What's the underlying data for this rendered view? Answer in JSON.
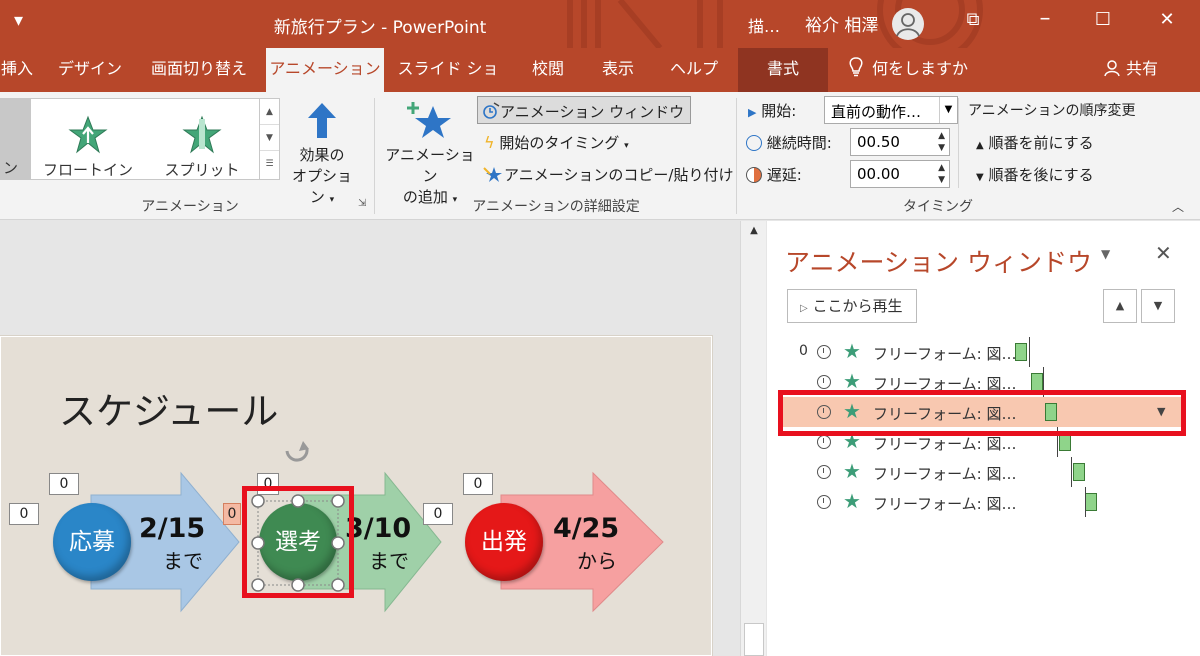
{
  "titlebar": {
    "qat_icon": "▾",
    "title": "新旅行プラン - PowerPoint",
    "cut_text": "描…",
    "user_name": "裕介 相澤",
    "restore_icon": "⧉",
    "maximize_icon": "☐",
    "close_icon": "✕"
  },
  "tabs": [
    {
      "label": "挿入"
    },
    {
      "label": "デザイン"
    },
    {
      "label": "画面切り替え"
    },
    {
      "label": "アニメーション"
    },
    {
      "label": "スライド ショー"
    },
    {
      "label": "校閲"
    },
    {
      "label": "表示"
    },
    {
      "label": "ヘルプ"
    },
    {
      "label": "書式"
    }
  ],
  "tell_me": "何をしますか",
  "share": "共有",
  "ribbon": {
    "gallery_first_fragment": "ン",
    "float_in": "フロートイン",
    "split": "スプリット",
    "effect_options_1": "効果の",
    "effect_options_2": "オプション",
    "group_animation": "アニメーション",
    "add_animation_1": "アニメーション",
    "add_animation_2": "の追加",
    "animation_pane": "アニメーション ウィンドウ",
    "trigger": "開始のタイミング",
    "painter": "アニメーションのコピー/貼り付け",
    "group_advanced": "アニメーションの詳細設定",
    "start_label": "開始:",
    "start_value": "直前の動作…",
    "duration_label": "継続時間:",
    "duration_value": "00.50",
    "delay_label": "遅延:",
    "delay_value": "00.00",
    "group_timing": "タイミング",
    "reorder_title": "アニメーションの順序変更",
    "move_earlier": "順番を前にする",
    "move_later": "順番を後にする"
  },
  "slide": {
    "title": "スケジュール",
    "steps": [
      {
        "circle": "応募",
        "date": "2/15",
        "sub": "まで"
      },
      {
        "circle": "選考",
        "date": "3/10",
        "sub": "まで"
      },
      {
        "circle": "出発",
        "date": "4/25",
        "sub": "から"
      }
    ],
    "tags": [
      "0",
      "0",
      "0",
      "0",
      "0",
      "0"
    ]
  },
  "pane": {
    "title": "アニメーション ウィンドウ",
    "play_from": "ここから再生",
    "rows": [
      {
        "index": "0",
        "label": "フリーフォーム: 図…"
      },
      {
        "index": "",
        "label": "フリーフォーム: 図…"
      },
      {
        "index": "",
        "label": "フリーフォーム: 図…"
      },
      {
        "index": "",
        "label": "フリーフォーム: 図…"
      },
      {
        "index": "",
        "label": "フリーフォーム: 図…"
      },
      {
        "index": "",
        "label": "フリーフォーム: 図…"
      }
    ]
  },
  "colors": {
    "ppt_accent": "#b7472a",
    "highlight": "#e8101e",
    "selected_row": "#f8c8b0",
    "circle_blue": "#2a86c8",
    "circle_green": "#3f8a52",
    "circle_red": "#e51818"
  }
}
